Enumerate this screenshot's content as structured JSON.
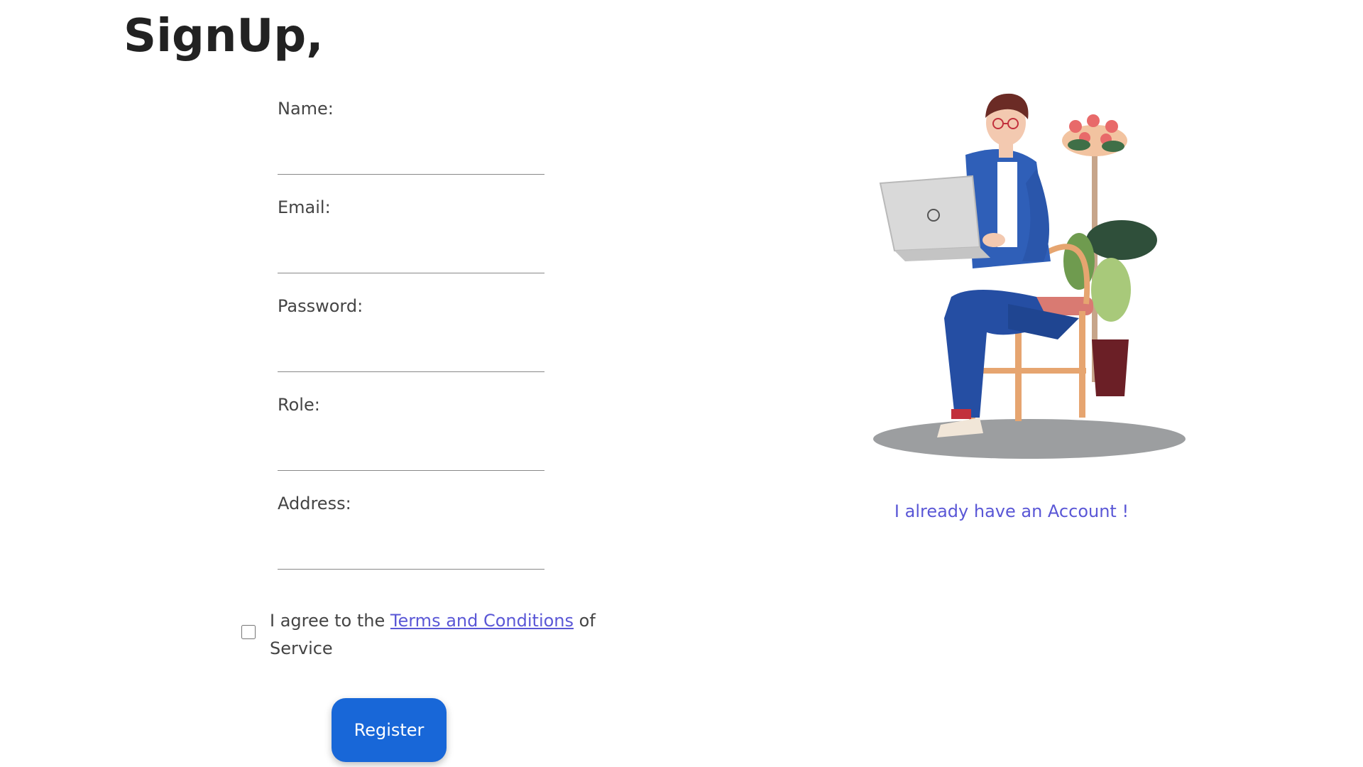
{
  "page": {
    "title": "SignUp,"
  },
  "form": {
    "fields": [
      {
        "label": "Name:",
        "value": ""
      },
      {
        "label": "Email:",
        "value": ""
      },
      {
        "label": "Password:",
        "value": ""
      },
      {
        "label": "Role:",
        "value": ""
      },
      {
        "label": "Address:",
        "value": ""
      }
    ],
    "agreement": {
      "prefix": "I agree to the ",
      "link_text": "Terms and Conditions",
      "suffix": " of Service",
      "checked": false
    },
    "register_label": "Register"
  },
  "sidebar": {
    "login_link": "I already have an Account !"
  },
  "colors": {
    "accent": "#1867d8",
    "link": "#5a57d6"
  }
}
